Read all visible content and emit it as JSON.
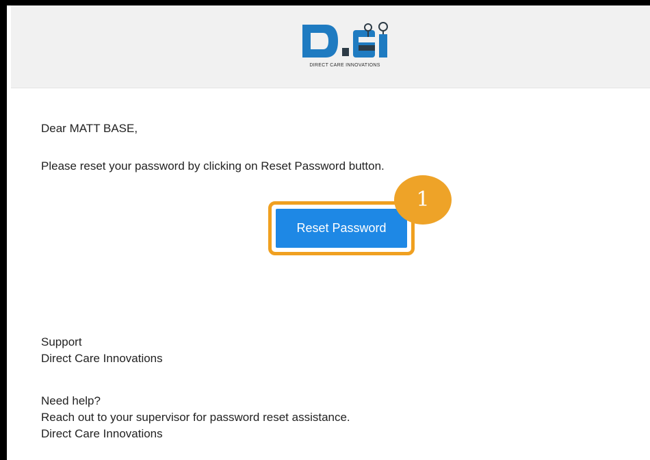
{
  "header": {
    "logo_caption": "DIRECT CARE INNOVATIONS",
    "logo_icon": "dci-logo-icon",
    "background": "#f1f1f1"
  },
  "email": {
    "greeting": "Dear MATT BASE,",
    "instruction": "Please reset your password by clicking on Reset Password button.",
    "button_label": "Reset Password",
    "button_color": "#1e88e5",
    "signature": {
      "line1": "Support",
      "line2": "Direct Care Innovations"
    },
    "help": {
      "line1": "Need help?",
      "line2": "Reach out to your supervisor for password reset assistance.",
      "line3": "Direct Care Innovations"
    }
  },
  "annotation": {
    "step_number": "1",
    "highlight_color": "#f0a020",
    "badge_color": "#eea328"
  }
}
